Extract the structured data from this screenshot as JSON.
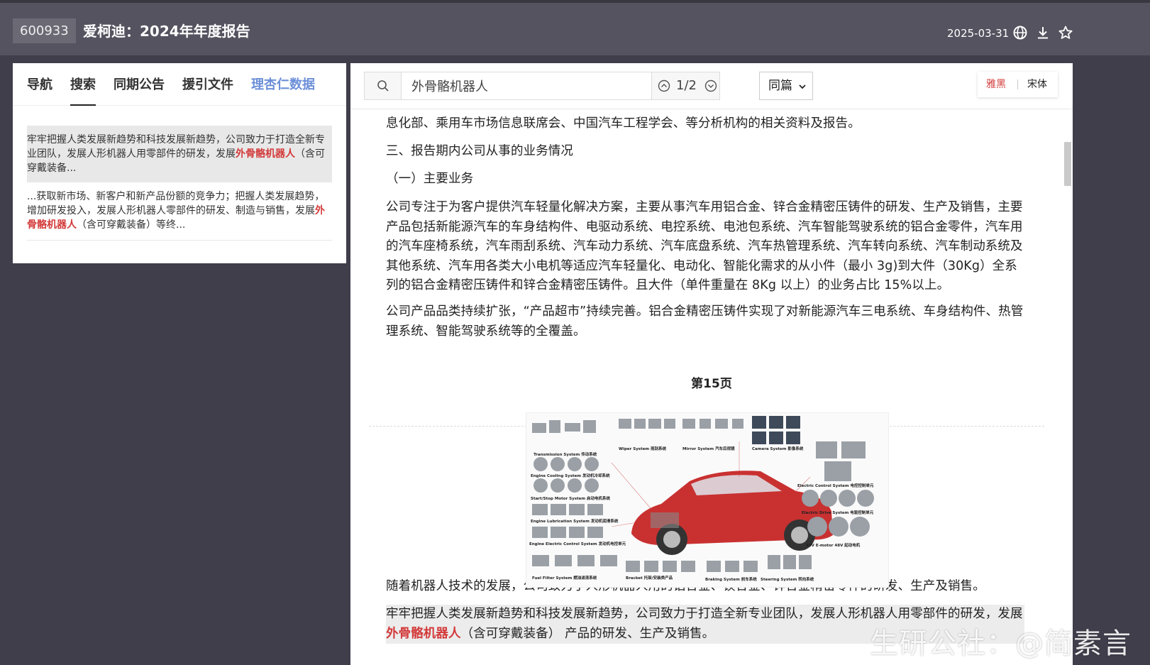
{
  "header": {
    "stock_code": "600933",
    "title": "爱柯迪：2024年年度报告",
    "date": "2025-03-31",
    "icons": [
      "globe-icon",
      "download-icon",
      "star-icon"
    ]
  },
  "left_panel": {
    "tabs": [
      {
        "label": "导航"
      },
      {
        "label": "搜索"
      },
      {
        "label": "同期公告"
      },
      {
        "label": "援引文件"
      },
      {
        "label": "理杏仁数据"
      }
    ],
    "results": [
      {
        "before": "牢牢把握人类发展新趋势和科技发展新趋势，公司致力于打造全新专业团队，发展人形机器人用零部件的研发，发展",
        "match": "外骨骼机器人",
        "after": "（含可穿戴装备..."
      },
      {
        "before": "...获取新市场、新客户和新产品份额的竞争力；把握人类发展趋势，增加研发投入，发展人形机器人零部件的研发、制造与销售，发展",
        "match": "外骨骼机器人",
        "after": "（含可穿戴装备）等终..."
      }
    ]
  },
  "toolbar": {
    "search_value": "外骨骼机器人",
    "match_count": "1/2",
    "scope": "同篇",
    "font_options": [
      "雅黑",
      "宋体"
    ],
    "accent_color": "#d33a3a"
  },
  "document": {
    "p1": "息化部、乘用车市场信息联席会、中国汽车工程学会、等分析机构的相关资料及报告。",
    "p2": "三、报告期内公司从事的业务情况",
    "p3": "（一）主要业务",
    "p4": "公司专注于为客户提供汽车轻量化解决方案，主要从事汽车用铝合金、锌合金精密压铸件的研发、生产及销售，主要产品包括新能源汽车的车身结构件、电驱动系统、电控系统、电池包系统、汽车智能驾驶系统的铝合金零件，汽车用的汽车座椅系统，汽车雨刮系统、汽车动力系统、汽车底盘系统、汽车热管理系统、汽车转向系统、汽车制动系统及其他系统、汽车用各类大小电机等适应汽车轻量化、电动化、智能化需求的从小件（最小 3g)到大件（30Kg）全系列的铝合金精密压铸件和锌合金精密压铸件。且大件（单件重量在 8Kg 以上）的业务占比 15%以上。",
    "p5": "公司产品品类持续扩张，“产品超市”持续完善。铝合金精密压铸件实现了对新能源汽车三电系统、车身结构件、热管理系统、智能驾驶系统等的全覆盖。",
    "page_label": "第15页",
    "p6": "随着机器人技术的发展，公司致力于人形机器人用的铝合金、镁合金、锌合金精密零件的研发、生产及销售。",
    "p7_before": "牢牢把握人类发展新趋势和科技发展新趋势，公司致力于打造全新专业团队，发展人形机器人用零部件的研发，发展",
    "p7_match": "外骨骼机器人",
    "p7_after": "（含可穿戴装备） 产品的研发、生产及销售。"
  },
  "figure": {
    "labels": [
      "Transmission System 传动系统",
      "Wiper System 雨刮系统",
      "Mirror System 汽车后视镜",
      "Camera System 影像系统",
      "Engine Cooling System 发动机冷却系统",
      "Start/Stop Motor System 启动电机系统",
      "Engine Lubrication System 发动机润滑系统",
      "Engine Electric Control System 发动机电控单元",
      "Electric Control System 电控控制单元",
      "Electric Drive System 电驱控制单元",
      "48V E-motor  48V 起动电机",
      "Fuel Filter System 燃油滤清系统",
      "Bracket 托架/安装类产品",
      "Braking System 刹车系统",
      "Steering System 转向系统"
    ]
  },
  "watermark": "生研公社：@简素言"
}
